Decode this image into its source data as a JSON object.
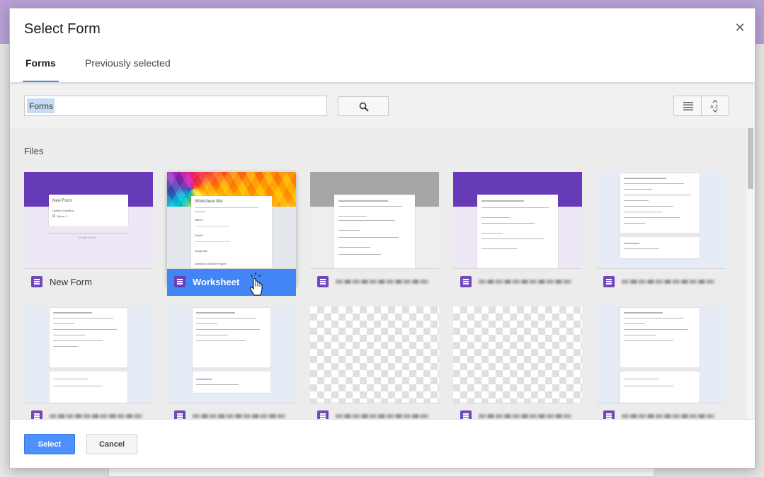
{
  "dialog": {
    "title": "Select Form",
    "close_icon": "close-icon",
    "tabs": [
      {
        "label": "Forms",
        "active": true
      },
      {
        "label": "Previously selected",
        "active": false
      }
    ]
  },
  "toolbar": {
    "search_value": "Forms",
    "search_icon": "search-icon",
    "list_view_icon": "list-view-icon",
    "sort_icon": "sort-az-icon"
  },
  "files": {
    "section_label": "Files",
    "items": [
      {
        "name": "New Form",
        "selected": false,
        "name_visible": true,
        "thumb_title": "New Form",
        "thumb_q": "Untitled Question",
        "thumb_opt": "Option 1",
        "thumb_footer": "Google Forms"
      },
      {
        "name": "Worksheet",
        "selected": true,
        "name_visible": true,
        "thumb_title": "Worksheet title",
        "thumb_req": "* Required",
        "thumb_q1": "Name *",
        "thumb_q2": "Email *",
        "thumb_q3": "Image title",
        "thumb_q4": "Question about the figure"
      },
      {
        "name": "",
        "selected": false,
        "name_visible": false
      },
      {
        "name": "",
        "selected": false,
        "name_visible": false
      },
      {
        "name": "",
        "selected": false,
        "name_visible": false
      },
      {
        "name": "",
        "selected": false,
        "name_visible": false
      },
      {
        "name": "",
        "selected": false,
        "name_visible": false
      },
      {
        "name": "",
        "selected": false,
        "name_visible": false
      },
      {
        "name": "",
        "selected": false,
        "name_visible": false
      },
      {
        "name": "",
        "selected": false,
        "name_visible": false
      }
    ]
  },
  "footer": {
    "select_label": "Select",
    "cancel_label": "Cancel"
  },
  "colors": {
    "accent": "#4285f4",
    "forms_purple": "#673ab7",
    "select_button": "#4d90fe"
  }
}
